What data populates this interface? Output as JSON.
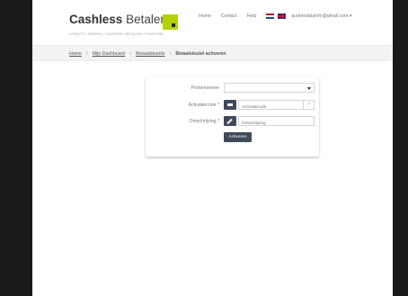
{
  "header": {
    "brand_bold": "Cashless",
    "brand_light": "Betalen",
    "tagline": "LOYALTY | SPAREN | COUPONS | BETALEN | TICKETING",
    "nav": [
      {
        "label": "Home"
      },
      {
        "label": "Contact"
      },
      {
        "label": "Help"
      }
    ],
    "user_email": "quotetodayinfo@gmail.com",
    "user_caret": "▾"
  },
  "breadcrumb": {
    "items": [
      {
        "label": "Home"
      },
      {
        "label": "Mijn Dashboard"
      },
      {
        "label": "Betaalsleutels"
      }
    ],
    "current": "Betaalsleutel activeren",
    "separator": ">"
  },
  "form": {
    "portemonnee_label": "Portemonnee",
    "portemonnee_value": "",
    "activatiecode_label": "Activatiecode *",
    "activatiecode_placeholder": "Activatiecode",
    "help_label": "?",
    "omschrijving_label": "Omschrijving *",
    "omschrijving_placeholder": "Omschrijving",
    "submit_label": "Activeren"
  },
  "colors": {
    "accent_dark": "#3e4a5c",
    "logo_green": "#b6d100",
    "crumb_bg": "#f3f3f3"
  }
}
